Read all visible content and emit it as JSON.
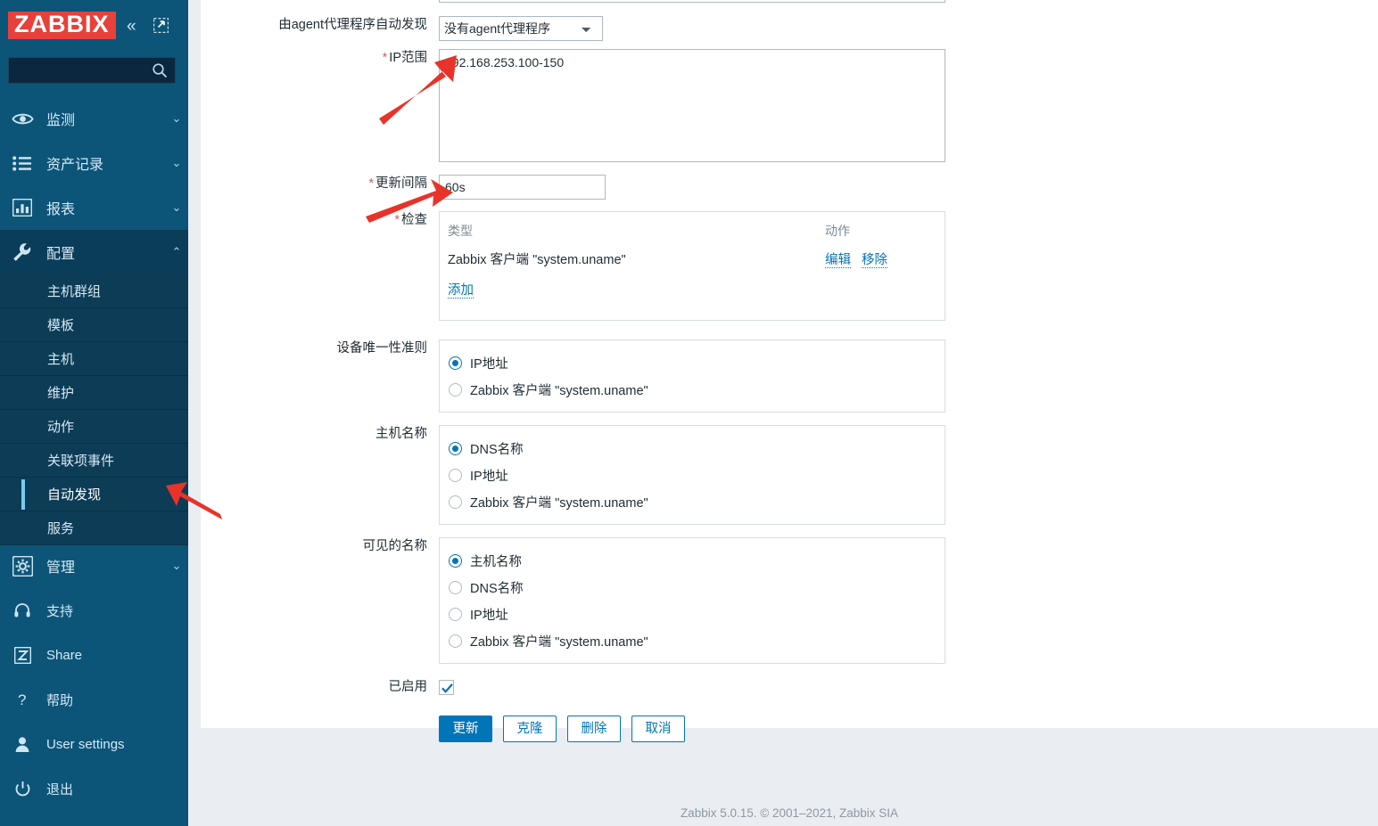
{
  "brand": {
    "logo": "ZABBIX",
    "collapse_icon": "chevrons-left-icon",
    "expand_icon": "expand-icon",
    "accent": "#0275b8",
    "sidebar_bg": "#0c5578",
    "logo_bg": "#e8403a"
  },
  "search": {
    "value": "",
    "placeholder": ""
  },
  "sidebar": {
    "items": [
      {
        "label": "监测",
        "icon": "eye-icon",
        "chevron": "chevron-down",
        "active": false
      },
      {
        "label": "资产记录",
        "icon": "list-icon",
        "chevron": "chevron-down",
        "active": false
      },
      {
        "label": "报表",
        "icon": "bar-chart-icon",
        "chevron": "chevron-down",
        "active": false
      },
      {
        "label": "配置",
        "icon": "wrench-icon",
        "chevron": "chevron-up",
        "active": true
      }
    ],
    "submenu": [
      {
        "label": "主机群组",
        "selected": false
      },
      {
        "label": "模板",
        "selected": false
      },
      {
        "label": "主机",
        "selected": false
      },
      {
        "label": "维护",
        "selected": false
      },
      {
        "label": "动作",
        "selected": false
      },
      {
        "label": "关联项事件",
        "selected": false
      },
      {
        "label": "自动发现",
        "selected": true
      },
      {
        "label": "服务",
        "selected": false
      }
    ],
    "admin": {
      "label": "管理",
      "icon": "gear-icon",
      "chevron": "chevron-down"
    },
    "bottom_items": [
      {
        "label": "支持",
        "icon": "headset-icon"
      },
      {
        "label": "Share",
        "icon": "zabbix-z-icon"
      },
      {
        "label": "帮助",
        "icon": "question-icon"
      },
      {
        "label": "User settings",
        "icon": "user-icon"
      },
      {
        "label": "退出",
        "icon": "power-icon"
      }
    ]
  },
  "form": {
    "proxy": {
      "label": "由agent代理程序自动发现",
      "value": "没有agent代理程序",
      "options": [
        "没有agent代理程序"
      ]
    },
    "ip_range": {
      "label": "IP范围",
      "required": true,
      "value": "192.168.253.100-150"
    },
    "update_interval": {
      "label": "更新间隔",
      "required": true,
      "value": "60s"
    },
    "checks": {
      "label": "检查",
      "required": true,
      "columns": [
        "类型",
        "动作"
      ],
      "rows": [
        {
          "type": "Zabbix 客户端 \"system.uname\"",
          "actions": [
            "编辑",
            "移除"
          ]
        }
      ],
      "add_label": "添加"
    },
    "device_uniqueness": {
      "label": "设备唯一性准则",
      "options": [
        {
          "label": "IP地址",
          "selected": true
        },
        {
          "label": "Zabbix 客户端 \"system.uname\"",
          "selected": false
        }
      ]
    },
    "host_name": {
      "label": "主机名称",
      "options": [
        {
          "label": "DNS名称",
          "selected": true
        },
        {
          "label": "IP地址",
          "selected": false
        },
        {
          "label": "Zabbix 客户端 \"system.uname\"",
          "selected": false
        }
      ]
    },
    "visible_name": {
      "label": "可见的名称",
      "options": [
        {
          "label": "主机名称",
          "selected": true
        },
        {
          "label": "DNS名称",
          "selected": false
        },
        {
          "label": "IP地址",
          "selected": false
        },
        {
          "label": "Zabbix 客户端 \"system.uname\"",
          "selected": false
        }
      ]
    },
    "enabled": {
      "label": "已启用",
      "checked": true
    },
    "buttons": {
      "update": "更新",
      "clone": "克隆",
      "delete": "删除",
      "cancel": "取消"
    }
  },
  "footer": {
    "text": "Zabbix 5.0.15. © 2001–2021, Zabbix SIA"
  },
  "annotations": {
    "arrow_color": "#e8332a",
    "arrows": [
      {
        "name": "arrow-to-ip-range",
        "points": "from lower-left to IP range field"
      },
      {
        "name": "arrow-to-update-interval",
        "points": "from lower-left to update interval field"
      },
      {
        "name": "arrow-to-discovery-menu",
        "points": "from lower-right to 自动发现 sidebar item"
      }
    ]
  }
}
